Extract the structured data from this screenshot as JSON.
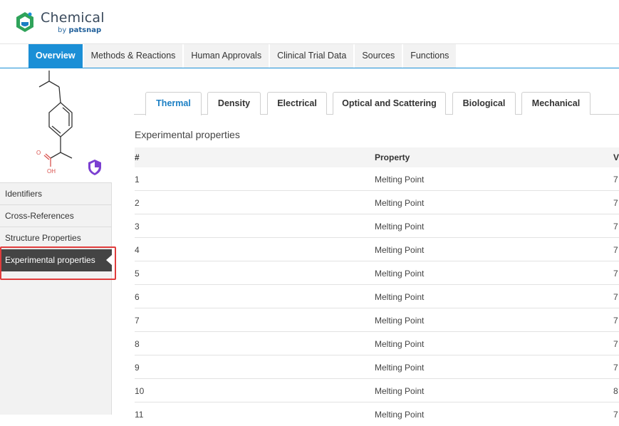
{
  "brand": {
    "name": "Chemical",
    "sub_prefix": "by ",
    "sub_name": "patsnap"
  },
  "topnav": {
    "tabs": [
      {
        "label": "Overview",
        "active": true
      },
      {
        "label": "Methods & Reactions"
      },
      {
        "label": "Human Approvals"
      },
      {
        "label": "Clinical Trial Data"
      },
      {
        "label": "Sources"
      },
      {
        "label": "Functions"
      }
    ]
  },
  "structure": {
    "label_o": "O",
    "label_oh": "OH"
  },
  "sidebar": {
    "items": [
      {
        "label": "Identifiers"
      },
      {
        "label": "Cross-References"
      },
      {
        "label": "Structure Properties"
      },
      {
        "label": "Experimental properties",
        "active": true
      }
    ]
  },
  "content_tabs": [
    {
      "label": "Thermal",
      "active": true
    },
    {
      "label": "Density"
    },
    {
      "label": "Electrical"
    },
    {
      "label": "Optical and Scattering"
    },
    {
      "label": "Biological"
    },
    {
      "label": "Mechanical"
    }
  ],
  "section_title": "Experimental properties",
  "table": {
    "headers": {
      "num": "#",
      "property": "Property",
      "value": "V"
    },
    "rows": [
      {
        "num": "1",
        "property": "Melting Point",
        "value": "7"
      },
      {
        "num": "2",
        "property": "Melting Point",
        "value": "7"
      },
      {
        "num": "3",
        "property": "Melting Point",
        "value": "7"
      },
      {
        "num": "4",
        "property": "Melting Point",
        "value": "7"
      },
      {
        "num": "5",
        "property": "Melting Point",
        "value": "7"
      },
      {
        "num": "6",
        "property": "Melting Point",
        "value": "7"
      },
      {
        "num": "7",
        "property": "Melting Point",
        "value": "7"
      },
      {
        "num": "8",
        "property": "Melting Point",
        "value": "7"
      },
      {
        "num": "9",
        "property": "Melting Point",
        "value": "7"
      },
      {
        "num": "10",
        "property": "Melting Point",
        "value": "8"
      },
      {
        "num": "11",
        "property": "Melting Point",
        "value": "7"
      }
    ]
  },
  "colors": {
    "accent": "#1b8fd6",
    "highlight": "#e03c3c",
    "shield": "#7b3fd1"
  }
}
